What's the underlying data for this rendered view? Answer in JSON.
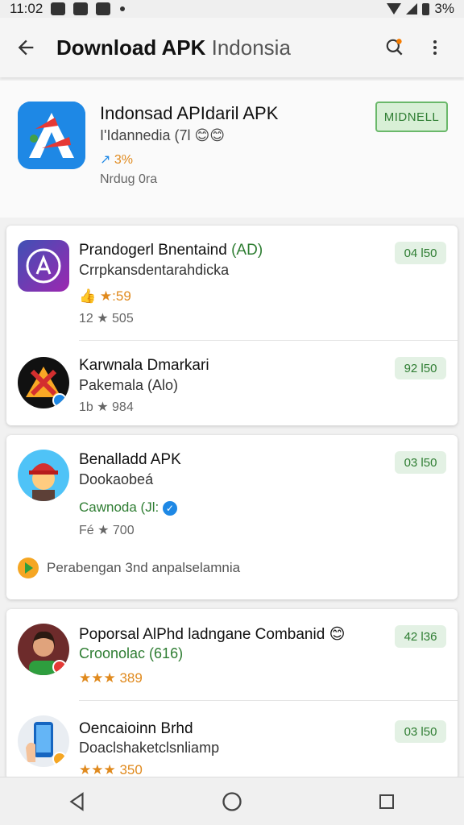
{
  "status": {
    "time": "11:02",
    "battery": "3%"
  },
  "appbar": {
    "title_bold": "Download APK",
    "title_light": "Indonsia"
  },
  "header": {
    "title": "Indonsad APIdaril APK",
    "sub": "I'Idannedia (7l",
    "rating": "3%",
    "size": "Nrdug 0ra",
    "install_label": "MIDNELL"
  },
  "lists": [
    {
      "rows": [
        {
          "title": "Prandogerl Bnentaind",
          "title_tag": "(AD)",
          "sub": "Crrpkansdentarahdicka",
          "rating": "★:59",
          "meta": "12 ★ 505",
          "price": "04 l50",
          "icon": "appstore-icon"
        },
        {
          "title": "Karwnala Dmarkari",
          "sub": "Pakemala (Alo)",
          "meta": "1b ★ 984",
          "price": "92 l50",
          "icon": "warning-icon"
        }
      ]
    },
    {
      "rows": [
        {
          "title": "Benalladd APK",
          "sub": "Dookaobeá",
          "tag": "Cawnoda (Jl:",
          "meta": "Fé ★ 700",
          "price": "03 l50",
          "icon": "firefighter-avatar-icon"
        }
      ],
      "note": "Perabengan 3nd anpalselamnia"
    },
    {
      "rows": [
        {
          "title": "Poporsal AlPhd ladngane Combanid",
          "sub": "Croonolac (616)",
          "rating": "★★★ 389",
          "price": "42 l36",
          "icon": "woman-avatar-icon"
        },
        {
          "title": "Oencaioinn Brhd",
          "sub": "Doaclshaketclsnliamp",
          "rating": "★★★ 350",
          "price": "03 l50",
          "icon": "phone-hand-icon"
        }
      ]
    }
  ],
  "colors": {
    "accent": "#2e7d32",
    "star": "#e08a1e",
    "brand_blue": "#1e88e5"
  }
}
